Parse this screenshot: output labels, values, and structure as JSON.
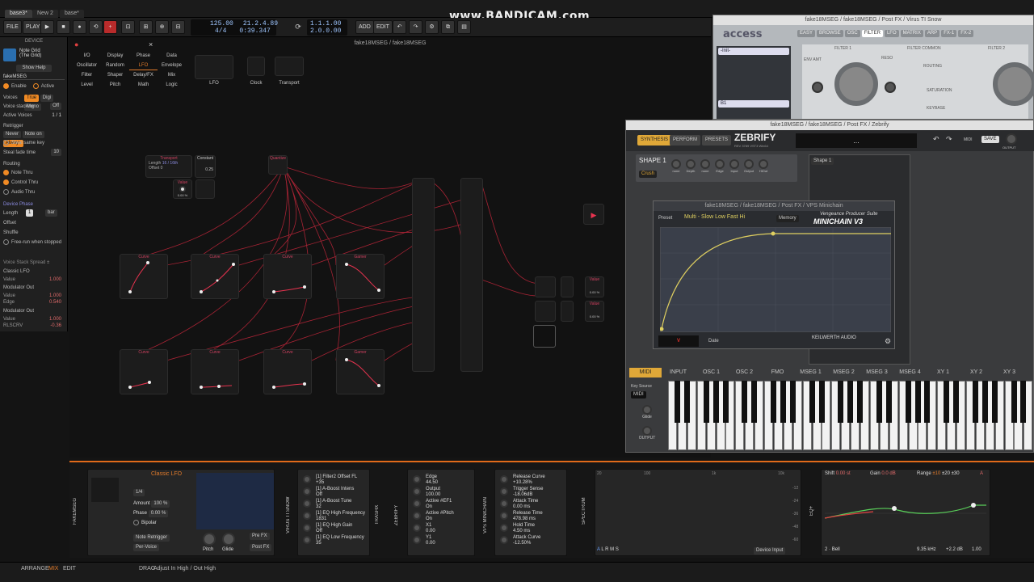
{
  "tabs": [
    {
      "label": "base3*"
    },
    {
      "label": "New 2"
    },
    {
      "label": "base*"
    }
  ],
  "watermark": "www.BANDICAM.com",
  "transport": {
    "file": "FILE",
    "play": "PLAY",
    "tempo": "125.00",
    "signature": "4/4",
    "position": "21.2.4.89",
    "time": "0:39.347",
    "loop_start": "1.1.1.00",
    "loop_len": "2.0.0.00",
    "add": "ADD",
    "edit": "EDIT"
  },
  "device_panel": {
    "header": "DEVICE",
    "preset_line1": "Note Grid",
    "preset_line2": "(The Grid)",
    "show_help": "Show Help",
    "name": "fakeMSEG",
    "enable": "Enable",
    "active": "Active",
    "voices": "Voices",
    "voice_modes": [
      "True",
      "Digi",
      "Mono"
    ],
    "voice_stacking": "Voice stacking",
    "voice_stacking_val": "Off",
    "active_voices": "Active Voices",
    "active_voices_val": "1 / 1",
    "retrigger": "Retrigger",
    "retrigger_opts": [
      "Never",
      "Note on",
      "Always"
    ],
    "steal_same_key": "Steal same key",
    "steal_fade_time": "Steal fade time",
    "steal_fade_val": "10",
    "routing": "Routing",
    "note_thru": "Note Thru",
    "control_thru": "Control Thru",
    "audio_thru": "Audio Thru",
    "device_phase": "Device Phase",
    "length": "Length",
    "length_val": "1",
    "length_unit": "bar",
    "offset": "Offset",
    "shuffle": "Shuffle",
    "free_run": "Free-run when stopped",
    "voice_stack_spread": "Voice Stack Spread ±",
    "classic_lfo": "Classic LFO",
    "value": "Value",
    "val1": "1.000",
    "modulator_out": "Modulator Out",
    "mo1_value": "1.000",
    "mo1_edge": "Edge",
    "mo1_edge_val": "0.540",
    "modulator_out2": "Modulator Out",
    "mo2_value": "1.000",
    "mo2_rlscrv": "RLSCRV",
    "mo2_rlscrv_val": "-0.36"
  },
  "grid": {
    "title": "fake18MSEG / fake18MSEG",
    "categories": [
      [
        "I/O",
        "Display",
        "Phase",
        "Data"
      ],
      [
        "Oscillator",
        "Random",
        "LFO",
        "Envelope"
      ],
      [
        "Filter",
        "Shaper",
        "Delay/FX",
        "Mix"
      ],
      [
        "Level",
        "Pitch",
        "Math",
        "Logic"
      ]
    ],
    "selected_category": "LFO",
    "palette": [
      {
        "label": "LFO"
      },
      {
        "label": "Clock"
      },
      {
        "label": "Transport"
      }
    ],
    "nodes_top": [
      {
        "title": "Transport",
        "label": "Length",
        "sub": "Offset",
        "v1": "16 / 16th",
        "v2": "0"
      },
      {
        "title": "Constant",
        "v": "0.25"
      },
      {
        "title": "Quantize"
      }
    ],
    "value_node": {
      "title": "Value",
      "v": "0.00 %"
    },
    "row1": [
      {
        "title": "Curve"
      },
      {
        "title": "Curve"
      },
      {
        "title": "Curve"
      },
      {
        "title": "Gamer"
      }
    ],
    "row2": [
      {
        "title": "Curve"
      },
      {
        "title": "Curve"
      },
      {
        "title": "Curve"
      },
      {
        "title": "Gamer"
      }
    ],
    "out_nodes": [
      {
        "title": "Value",
        "v": "0.00 %"
      },
      {
        "title": "Value",
        "v": "0.00 %"
      }
    ]
  },
  "virus": {
    "title": "fake18MSEG / fake18MSEG / Post FX / Virus TI Snow",
    "brand": "access",
    "tabs": [
      "EASY",
      "BROWSE",
      "OSC",
      "FILTER",
      "LFO",
      "MATRIX",
      "ARP",
      "FX-1",
      "FX-2"
    ],
    "patch1": "-Init-",
    "patch2": "B1",
    "labels": [
      "FILTER 1",
      "FILTER COMMON",
      "FILTER 2",
      "ROUTING",
      "SATURATION",
      "KEYBASE",
      "RESO",
      "ENV AMT"
    ]
  },
  "zebrify": {
    "title": "fake18MSEG / fake18MSEG / Post FX / Zebrify",
    "tabs": [
      "SYNTHESIS",
      "PERFORM",
      "PRESETS"
    ],
    "logo": "ZEBRIFY",
    "version": "REV 3789   VST3   Win64",
    "preset": "...",
    "midi": "MIDI",
    "save": "SAVE",
    "output": "OUTPUT",
    "shape": "SHAPE 1",
    "crush": "Crush",
    "knobs": [
      "none",
      "Depth",
      "none",
      "Edge",
      "Input",
      "Output",
      "HiOut"
    ],
    "shape_tab": "Shape 1",
    "bottom_tabs": [
      "MIDI",
      "INPUT",
      "OSC 1",
      "OSC 2",
      "FMO",
      "MSEG 1",
      "MSEG 2",
      "MSEG 3",
      "MSEG 4",
      "XY 1",
      "XY 2",
      "XY 3"
    ],
    "key_source": "Key Source",
    "key_source_val": "MIDI",
    "glide": "Glide",
    "output2": "OUTPUT"
  },
  "minichain": {
    "title": "fake18MSEG / fake18MSEG / Post FX / VPS Minichain",
    "brand_top": "Vengeance Producer Suite",
    "brand": "MINICHAIN V3",
    "preset_label": "Preset",
    "preset": "Multi - Slow Low Fast Hi",
    "memory": "Memory",
    "date": "Date",
    "kw": "KEILWERTH AUDIO"
  },
  "chain": {
    "fakemseg_label": "FAKEMSEG",
    "classic_lfo": {
      "title": "Classic LFO",
      "rate": "1/4",
      "amount": "Amount",
      "amount_val": "100 %",
      "phase": "Phase",
      "phase_val": "0.00 %",
      "bipolar": "Bipolar",
      "retrig": "Note Retrigger",
      "pervoice": "Per-Voice",
      "pitch": "Pitch",
      "glide": "Glide",
      "prefx": "Pre FX",
      "postfx": "Post FX"
    },
    "virus_label": "VIRUS TI SNOW",
    "virus_params": [
      {
        "name": "[1] Filter2 Offset FL",
        "val": "+35"
      },
      {
        "name": "[1] A-Boost Intens",
        "val": "Off"
      },
      {
        "name": "[1] A-Boost Tune",
        "val": "32"
      },
      {
        "name": "[1] EQ High Frequency",
        "val": "1831"
      },
      {
        "name": "[1] EQ High Gain",
        "val": "Off"
      },
      {
        "name": "[1] EQ Low Frequency",
        "val": "35"
      }
    ],
    "trash_label": "TRASHX",
    "zebrify_label": "ZEBRIFY",
    "zeb_params": [
      {
        "name": "Edge",
        "val": "44.50"
      },
      {
        "name": "Output",
        "val": "100.00"
      },
      {
        "name": "Active #EF1",
        "val": "On"
      },
      {
        "name": "Active #Pitch",
        "val": "On"
      },
      {
        "name": "X1",
        "val": "0.00"
      },
      {
        "name": "Y1",
        "val": "0.00"
      }
    ],
    "mini_label": "VPS MINICHAIN",
    "mini_params": [
      {
        "name": "Release Curve",
        "val": "+10.28%"
      },
      {
        "name": "Trigger Sense",
        "val": "-18.06dB"
      },
      {
        "name": "Attack Time",
        "val": "0.00 ms"
      },
      {
        "name": "Release Time",
        "val": "478.98 ms"
      },
      {
        "name": "Hold Time",
        "val": "4.50 ms"
      },
      {
        "name": "Attack Curve",
        "val": "-12.50%"
      }
    ],
    "spectrum_label": "SPECTRUM",
    "spec_ticks": [
      "20",
      "100",
      "1k",
      "10k"
    ],
    "spec_db": [
      "-12",
      "-24",
      "-36",
      "-48",
      "-60"
    ],
    "spec_modes": [
      "A",
      "L",
      "R",
      "M",
      "S"
    ],
    "device_input": "Device Input",
    "eq_label": "EQ+",
    "eq": {
      "shift": "Shift",
      "shift_val": "0.00 st",
      "gain": "Gain",
      "gain_val": "0.0 dB",
      "range": "Range",
      "range_opts": [
        "±10",
        "±20",
        "±30"
      ],
      "band": "2",
      "type": "Bell",
      "freq": "9.35 kHz",
      "gain2": "+2.2 dB",
      "q": "1.00",
      "a": "A"
    }
  },
  "status": {
    "arrange": "ARRANGE",
    "mix": "MIX",
    "edit": "EDIT",
    "drag": "DRAG",
    "hint": "Adjust In High / Out High"
  }
}
